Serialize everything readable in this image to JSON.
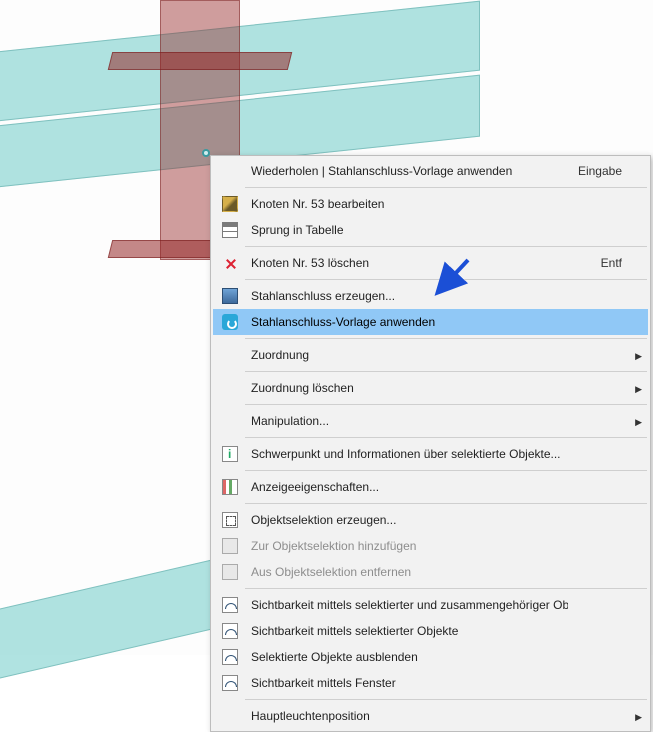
{
  "viewport": {
    "node_id": 53
  },
  "menu": {
    "items": [
      {
        "key": "redo",
        "label": "Wiederholen | Stahlanschluss-Vorlage anwenden",
        "shortcut": "Eingabe",
        "icon": "",
        "submenu": false,
        "enabled": true,
        "highlight": false
      },
      {
        "sep": true
      },
      {
        "key": "edit-node",
        "label": "Knoten Nr. 53 bearbeiten",
        "shortcut": "",
        "icon": "ico-edit",
        "submenu": false,
        "enabled": true,
        "highlight": false
      },
      {
        "key": "jump-table",
        "label": "Sprung in Tabelle",
        "shortcut": "",
        "icon": "ico-table",
        "submenu": false,
        "enabled": true,
        "highlight": false
      },
      {
        "sep": true
      },
      {
        "key": "delete-node",
        "label": "Knoten Nr. 53 löschen",
        "shortcut": "Entf",
        "icon": "ico-delete",
        "submenu": false,
        "enabled": true,
        "highlight": false
      },
      {
        "sep": true
      },
      {
        "key": "create-conn",
        "label": "Stahlanschluss erzeugen...",
        "shortcut": "",
        "icon": "ico-steel",
        "submenu": false,
        "enabled": true,
        "highlight": false
      },
      {
        "key": "apply-template",
        "label": "Stahlanschluss-Vorlage anwenden",
        "shortcut": "",
        "icon": "ico-template",
        "submenu": false,
        "enabled": true,
        "highlight": true
      },
      {
        "sep": true
      },
      {
        "key": "assign",
        "label": "Zuordnung",
        "shortcut": "",
        "icon": "",
        "submenu": true,
        "enabled": true,
        "highlight": false
      },
      {
        "sep": true
      },
      {
        "key": "unassign",
        "label": "Zuordnung löschen",
        "shortcut": "",
        "icon": "",
        "submenu": true,
        "enabled": true,
        "highlight": false
      },
      {
        "sep": true
      },
      {
        "key": "manipulate",
        "label": "Manipulation...",
        "shortcut": "",
        "icon": "",
        "submenu": true,
        "enabled": true,
        "highlight": false
      },
      {
        "sep": true
      },
      {
        "key": "centroid-info",
        "label": "Schwerpunkt und Informationen über selektierte Objekte...",
        "shortcut": "",
        "icon": "ico-info",
        "submenu": false,
        "enabled": true,
        "highlight": false
      },
      {
        "sep": true
      },
      {
        "key": "display-props",
        "label": "Anzeigeeigenschaften...",
        "shortcut": "",
        "icon": "ico-props",
        "submenu": false,
        "enabled": true,
        "highlight": false
      },
      {
        "sep": true
      },
      {
        "key": "create-objsel",
        "label": "Objektselektion erzeugen...",
        "shortcut": "",
        "icon": "ico-sel",
        "submenu": false,
        "enabled": true,
        "highlight": false
      },
      {
        "key": "add-objsel",
        "label": "Zur Objektselektion hinzufügen",
        "shortcut": "",
        "icon": "ico-generic",
        "submenu": false,
        "enabled": false,
        "highlight": false
      },
      {
        "key": "rem-objsel",
        "label": "Aus Objektselektion entfernen",
        "shortcut": "",
        "icon": "ico-generic",
        "submenu": false,
        "enabled": false,
        "highlight": false
      },
      {
        "sep": true
      },
      {
        "key": "vis-related",
        "label": "Sichtbarkeit mittels selektierter und zusammengehöriger Objekte",
        "shortcut": "",
        "icon": "ico-vis",
        "submenu": false,
        "enabled": true,
        "highlight": false
      },
      {
        "key": "vis-selected",
        "label": "Sichtbarkeit mittels selektierter Objekte",
        "shortcut": "",
        "icon": "ico-vis",
        "submenu": false,
        "enabled": true,
        "highlight": false
      },
      {
        "key": "hide-selected",
        "label": "Selektierte Objekte ausblenden",
        "shortcut": "",
        "icon": "ico-vis",
        "submenu": false,
        "enabled": true,
        "highlight": false
      },
      {
        "key": "vis-window",
        "label": "Sichtbarkeit mittels Fenster",
        "shortcut": "",
        "icon": "ico-vis",
        "submenu": false,
        "enabled": true,
        "highlight": false
      },
      {
        "sep": true
      },
      {
        "key": "mainlight",
        "label": "Hauptleuchtenposition",
        "shortcut": "",
        "icon": "",
        "submenu": true,
        "enabled": true,
        "highlight": false
      }
    ]
  },
  "annotation": {
    "arrow_color": "#1b4fd6"
  }
}
